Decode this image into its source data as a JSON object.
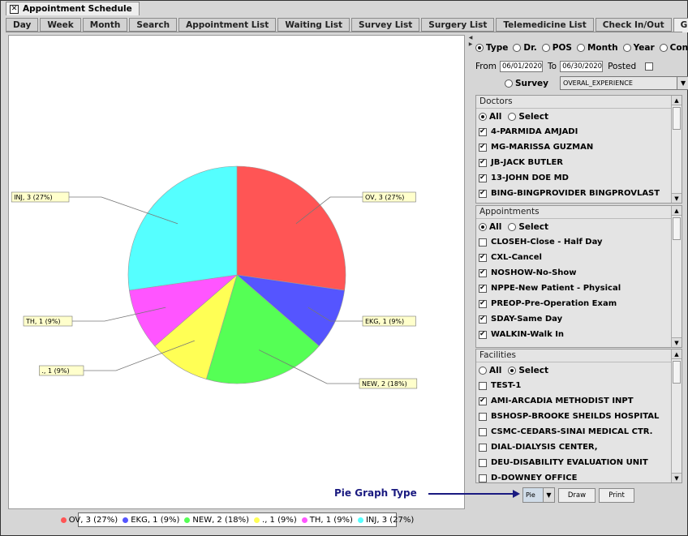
{
  "window": {
    "title": "Appointment Schedule",
    "close_icon": "close-icon"
  },
  "tabs": [
    "Day",
    "Week",
    "Month",
    "Search",
    "Appointment List",
    "Waiting List",
    "Survey List",
    "Surgery List",
    "Telemedicine List",
    "Check In/Out",
    "Graphs"
  ],
  "active_tab": "Graphs",
  "options": {
    "type_label": "Type",
    "dr_label": "Dr.",
    "pos_label": "POS",
    "month_label": "Month",
    "year_label": "Year",
    "confirm_label": "Confirm",
    "selected": "Type",
    "from_label": "From",
    "from_value": "06/01/2020",
    "to_label": "To",
    "to_value": "06/30/2020",
    "posted_label": "Posted",
    "survey_label": "Survey",
    "survey_value": "OVERAL_EXPERIENCE"
  },
  "doctors": {
    "header": "Doctors",
    "all_label": "All",
    "select_label": "Select",
    "mode": "All",
    "items": [
      {
        "label": "4-PARMIDA AMJADI",
        "checked": true
      },
      {
        "label": "MG-MARISSA GUZMAN",
        "checked": true
      },
      {
        "label": "JB-JACK BUTLER",
        "checked": true
      },
      {
        "label": "13-JOHN DOE MD",
        "checked": true
      },
      {
        "label": "BING-BINGPROVIDER BINGPROVLAST",
        "checked": true
      }
    ]
  },
  "appointments": {
    "header": "Appointments",
    "all_label": "All",
    "select_label": "Select",
    "mode": "All",
    "items": [
      {
        "label": "CLOSEH-Close - Half Day",
        "checked": false
      },
      {
        "label": "CXL-Cancel",
        "checked": true
      },
      {
        "label": "NOSHOW-No-Show",
        "checked": true
      },
      {
        "label": "NPPE-New Patient - Physical",
        "checked": true
      },
      {
        "label": "PREOP-Pre-Operation Exam",
        "checked": true
      },
      {
        "label": "SDAY-Same Day",
        "checked": true
      },
      {
        "label": "WALKIN-Walk In",
        "checked": true
      }
    ]
  },
  "facilities": {
    "header": "Facilities",
    "all_label": "All",
    "select_label": "Select",
    "mode": "Select",
    "items": [
      {
        "label": "TEST-1",
        "checked": false
      },
      {
        "label": "AMI-ARCADIA METHODIST INPT",
        "checked": true
      },
      {
        "label": "BSHOSP-BROOKE SHEILDS HOSPITAL",
        "checked": false
      },
      {
        "label": "CSMC-CEDARS-SINAI MEDICAL CTR.",
        "checked": false
      },
      {
        "label": "DIAL-DIALYSIS CENTER,",
        "checked": false
      },
      {
        "label": "DEU-DISABILITY EVALUATION UNIT",
        "checked": false
      },
      {
        "label": "D-DOWNEY OFFICE",
        "checked": false
      }
    ]
  },
  "controls": {
    "graph_type": "Pie",
    "draw_label": "Draw",
    "print_label": "Print"
  },
  "annotation": "Pie Graph Type",
  "chart_data": {
    "type": "pie",
    "slices": [
      {
        "label": "OV, 3 (27%)",
        "value": 3,
        "color": "#ff5555"
      },
      {
        "label": "EKG, 1 (9%)",
        "value": 1,
        "color": "#5555ff"
      },
      {
        "label": "NEW, 2 (18%)",
        "value": 2,
        "color": "#55ff55"
      },
      {
        "label": "., 1 (9%)",
        "value": 1,
        "color": "#ffff55"
      },
      {
        "label": "TH, 1 (9%)",
        "value": 1,
        "color": "#ff55ff"
      },
      {
        "label": "INJ, 3 (27%)",
        "value": 3,
        "color": "#55ffff"
      }
    ],
    "legend_position": "bottom"
  }
}
